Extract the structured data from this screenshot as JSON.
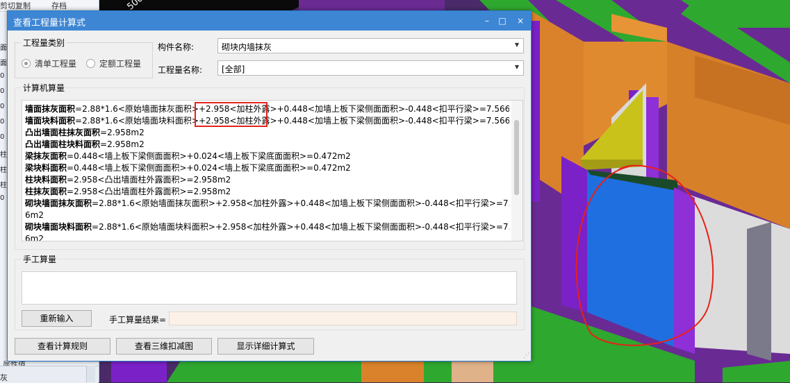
{
  "background_app": {
    "toolbar_items": [
      "剪切复制",
      "存档"
    ],
    "property_label": "属性值",
    "bottom_label": "灰",
    "side_labels": [
      "面",
      "面",
      "0",
      "0",
      "0",
      "0",
      "0",
      "柱",
      "柱",
      "柱",
      "0"
    ]
  },
  "viewport": {
    "dimension_text": "500"
  },
  "dialog": {
    "title": "查看工程量计算式",
    "window_buttons": [
      "–",
      "□",
      "×"
    ],
    "quantity_category": {
      "legend": "工程量类别",
      "options": [
        {
          "label": "清单工程量",
          "selected": true
        },
        {
          "label": "定额工程量",
          "selected": false
        }
      ]
    },
    "component_name": {
      "label": "构件名称:",
      "value": "砌块内墙抹灰"
    },
    "quantity_name": {
      "label": "工程量名称:",
      "value": "[全部]"
    },
    "computer_calc": {
      "legend": "计算机算量",
      "lines": [
        {
          "name": "墙面抹灰面积",
          "formula": "=2.88*1.6<原始墙面抹灰面积>+2.958<加柱外露>+0.448<加墙上板下梁侧面面积>-0.448<扣平行梁>=7.566m2"
        },
        {
          "name": "墙面块料面积",
          "formula": "=2.88*1.6<原始墙面块料面积>+2.958<加柱外露>+0.448<加墙上板下梁侧面面积>-0.448<扣平行梁>=7.566m2"
        },
        {
          "name": "凸出墙面柱抹灰面积",
          "formula": "=2.958m2"
        },
        {
          "name": "凸出墙面柱块料面积",
          "formula": "=2.958m2"
        },
        {
          "name": "梁抹灰面积",
          "formula": "=0.448<墙上板下梁侧面面积>+0.024<墙上板下梁底面面积>=0.472m2"
        },
        {
          "name": "梁块料面积",
          "formula": "=0.448<墙上板下梁侧面面积>+0.024<墙上板下梁底面面积>=0.472m2"
        },
        {
          "name": "柱块料面积",
          "formula": "=2.958<凸出墙面柱外露面积>=2.958m2"
        },
        {
          "name": "柱抹灰面积",
          "formula": "=2.958<凸出墙面柱外露面积>=2.958m2"
        },
        {
          "name": "砌块墙面抹灰面积",
          "formula": "=2.88*1.6<原始墙面抹灰面积>+2.958<加柱外露>+0.448<加墙上板下梁侧面面积>-0.448<扣平行梁>=7.56"
        },
        {
          "name": "",
          "formula": "6m2"
        },
        {
          "name": "砌块墙面块料面积",
          "formula": "=2.88*1.6<原始墙面块料面积>+2.958<加柱外露>+0.448<加墙上板下梁侧面面积>-0.448<扣平行梁>=7.56"
        },
        {
          "name": "",
          "formula": "6m2"
        }
      ]
    },
    "manual_calc": {
      "legend": "手工算量",
      "input_value": "",
      "reenter_button": "重新输入",
      "result_label": "手工算量结果=",
      "result_value": ""
    },
    "bottom_buttons": [
      "查看计算规则",
      "查看三维扣减图",
      "显示详细计算式"
    ]
  },
  "colors": {
    "title_bar": "#3d86d4",
    "highlight_box": "#e2231a",
    "annotation_circle": "#e8201a",
    "wall_orange": "#d9822b",
    "wall_purple": "#5b1a8a",
    "column_blue": "#1f6fe0",
    "beam_green": "#2fa82f"
  }
}
